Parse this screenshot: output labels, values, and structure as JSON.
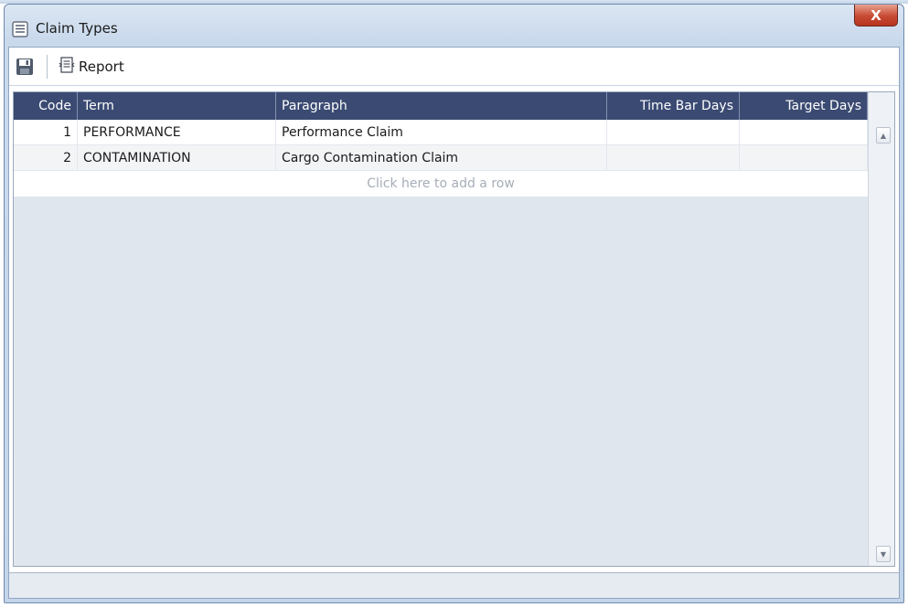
{
  "window": {
    "title": "Claim Types",
    "close_label": "X"
  },
  "toolbar": {
    "report_label": "Report"
  },
  "grid": {
    "columns": [
      "Code",
      "Term",
      "Paragraph",
      "Time Bar Days",
      "Target Days"
    ],
    "rows": [
      {
        "code": "1",
        "term": "PERFORMANCE",
        "paragraph": "Performance Claim",
        "time_bar_days": "",
        "target_days": ""
      },
      {
        "code": "2",
        "term": "CONTAMINATION",
        "paragraph": "Cargo Contamination Claim",
        "time_bar_days": "",
        "target_days": ""
      }
    ],
    "add_row_label": "Click here to add a row"
  },
  "icons": {
    "app": "list-window-icon",
    "save": "floppy-disk-icon",
    "report": "report-document-icon",
    "scroll_up": "arrow-up-icon",
    "scroll_down": "arrow-down-icon"
  },
  "colors": {
    "header_bg": "#3a4a72",
    "close_button": "#c74a33",
    "grid_bg": "#dfe6ee"
  }
}
